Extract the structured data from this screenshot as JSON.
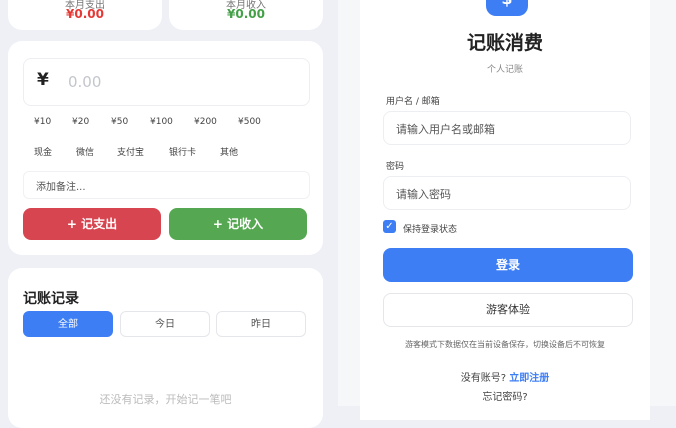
{
  "summary": {
    "expense_label": "本月支出",
    "expense_value": "¥0.00",
    "income_label": "本月收入",
    "income_value": "¥0.00"
  },
  "entry": {
    "currency_symbol": "¥",
    "amount_placeholder": "0.00",
    "quick_amounts": [
      "¥10",
      "¥20",
      "¥50",
      "¥100",
      "¥200",
      "¥500"
    ],
    "payment_methods": [
      "现金",
      "微信",
      "支付宝",
      "银行卡",
      "其他"
    ],
    "note_placeholder": "添加备注...",
    "expense_button": "+ 记支出",
    "income_button": "+ 记收入"
  },
  "records": {
    "title": "记账记录",
    "filters": [
      "全部",
      "今日",
      "昨日"
    ],
    "empty_text": "还没有记录，开始记一笔吧"
  },
  "login": {
    "logo_symbol": "$",
    "title": "记账消费",
    "subtitle": "个人记账",
    "username_label": "用户名 / 邮箱",
    "username_placeholder": "请输入用户名或邮箱",
    "password_label": "密码",
    "password_placeholder": "请输入密码",
    "remember_label": "保持登录状态",
    "login_button": "登录",
    "guest_button": "游客体验",
    "guest_note": "游客模式下数据仅在当前设备保存，切换设备后不可恢复",
    "no_account": "没有账号?",
    "register_link": "立即注册",
    "forgot": "忘记密码?"
  },
  "colors": {
    "primary": "#3d7ef5",
    "expense": "#d64550",
    "income": "#55a851"
  }
}
